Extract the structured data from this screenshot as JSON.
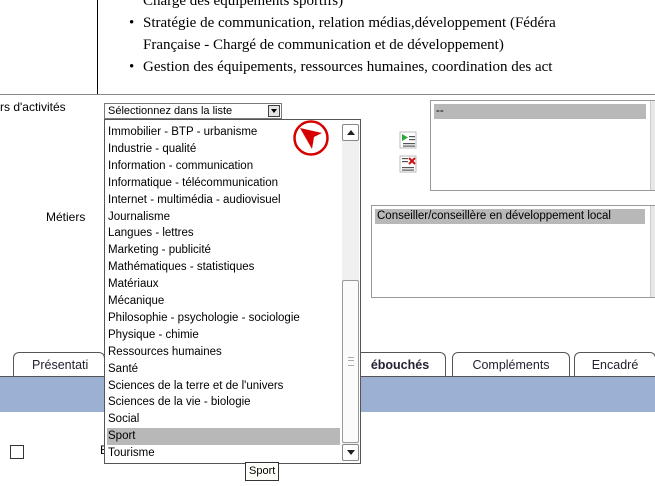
{
  "bullets": {
    "line0": "Charge des équipements sportifs)",
    "line1": "Stratégie de communication, relation médias,développement (Fédéra",
    "line1b": "Française - Chargé de communication et de développement)",
    "line2": "Gestion des équipements, ressources humaines, coordination des act"
  },
  "form": {
    "secteurs_label": "rs d'activités",
    "metiers_label": "Métiers",
    "select_value": "Sélectionnez dans la liste"
  },
  "dropdown": {
    "options": [
      "Immobilier - BTP - urbanisme",
      "Industrie - qualité",
      "Information - communication",
      "Informatique - télécommunication",
      "Internet - multimédia - audiovisuel",
      "Journalisme",
      "Langues - lettres",
      "Marketing - publicité",
      "Mathématiques - statistiques",
      "Matériaux",
      "Mécanique",
      "Philosophie - psychologie - sociologie",
      "Physique - chimie",
      "Ressources humaines",
      "Santé",
      "Sciences de la terre et de l'univers",
      "Sciences de la vie - biologie",
      "Social",
      "Sport",
      "Tourisme"
    ],
    "selected": "Sport"
  },
  "listbox_secteurs": {
    "item": "--"
  },
  "listbox_metiers": {
    "item": "Conseiller/conseillère en développement local"
  },
  "tabs": [
    "Présentati",
    "ébouchés",
    "Compléments",
    "Encadré"
  ],
  "active_tab": "ébouchés",
  "tooltip": "Sport",
  "stray_text": "E",
  "colors": {
    "selection": "#b8b8b8",
    "band": "#9cb0d3",
    "marker": "#d60000"
  }
}
